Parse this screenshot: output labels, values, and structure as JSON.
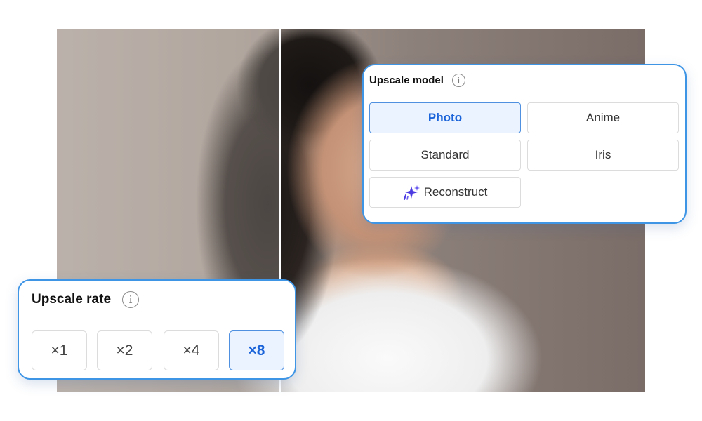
{
  "upscale_model": {
    "title": "Upscale model",
    "info_icon": "i",
    "options": [
      {
        "label": "Photo",
        "selected": true
      },
      {
        "label": "Anime",
        "selected": false
      },
      {
        "label": "Standard",
        "selected": false
      },
      {
        "label": "Iris",
        "selected": false
      },
      {
        "label": "Reconstruct",
        "selected": false,
        "icon": "sparkle-icon"
      }
    ]
  },
  "upscale_rate": {
    "title": "Upscale rate",
    "info_icon": "i",
    "options": [
      {
        "label": "×1",
        "selected": false
      },
      {
        "label": "×2",
        "selected": false
      },
      {
        "label": "×4",
        "selected": false
      },
      {
        "label": "×8",
        "selected": true
      }
    ]
  },
  "colors": {
    "accent": "#3e95e6",
    "selected_bg": "#eaf3ff",
    "selected_text": "#1a63d9",
    "sparkle": "#4b3be0"
  }
}
